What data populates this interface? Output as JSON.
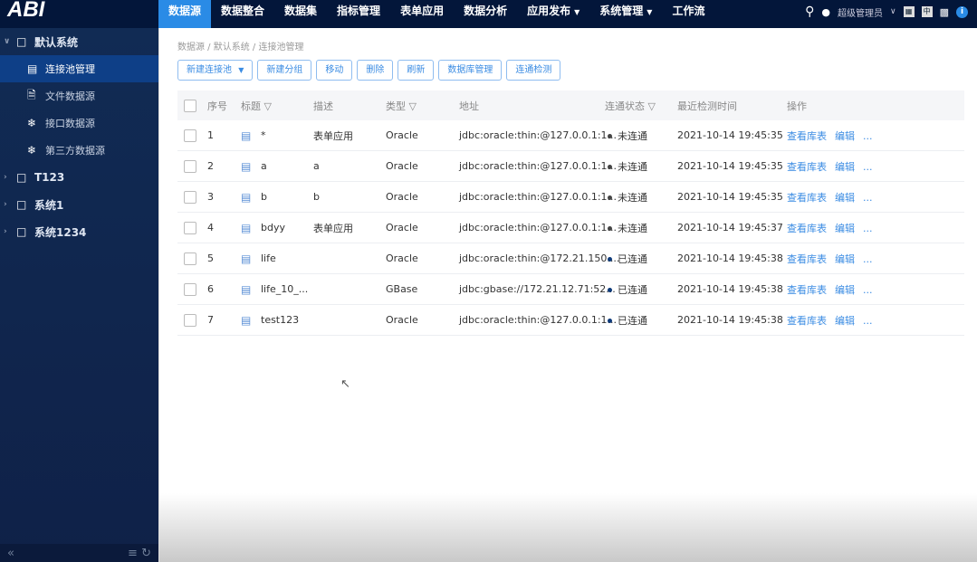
{
  "app": {
    "logo": "ABI"
  },
  "nav": [
    {
      "label": "数据源",
      "active": true
    },
    {
      "label": "数据整合"
    },
    {
      "label": "数据集"
    },
    {
      "label": "指标管理"
    },
    {
      "label": "表单应用"
    },
    {
      "label": "数据分析"
    },
    {
      "label": "应用发布",
      "dropdown": true
    },
    {
      "label": "系统管理",
      "dropdown": true
    },
    {
      "label": "工作流"
    }
  ],
  "header": {
    "user": "超级管理员",
    "lang": "中"
  },
  "sidebar": {
    "groups": [
      {
        "label": "默认系统",
        "expanded": true,
        "items": [
          {
            "label": "连接池管理",
            "selected": true
          },
          {
            "label": "文件数据源"
          },
          {
            "label": "接口数据源"
          },
          {
            "label": "第三方数据源"
          }
        ]
      },
      {
        "label": "T123"
      },
      {
        "label": "系统1"
      },
      {
        "label": "系统1234"
      }
    ]
  },
  "breadcrumb": "数据源 / 默认系统 / 连接池管理",
  "toolbar": {
    "new_pool": "新建连接池",
    "new_group": "新建分组",
    "move": "移动",
    "delete": "删除",
    "refresh": "刷新",
    "db_manage": "数据库管理",
    "check": "连通检测"
  },
  "table": {
    "headers": {
      "index": "序号",
      "title": "标题",
      "desc": "描述",
      "type": "类型",
      "address": "地址",
      "status": "连通状态",
      "time": "最近检测时间",
      "ops": "操作"
    },
    "ops": {
      "view": "查看库表",
      "edit": "编辑",
      "more": "..."
    },
    "status_colors": {
      "未连通": "#444444",
      "已连通": "#0d3a7a"
    },
    "rows": [
      {
        "index": "1",
        "title": "*",
        "desc": "表单应用",
        "type": "Oracle",
        "address": "jdbc:oracle:thin:@127.0.0.1:1...",
        "status": "未连通",
        "time": "2021-10-14 19:45:35"
      },
      {
        "index": "2",
        "title": "a",
        "desc": "a",
        "type": "Oracle",
        "address": "jdbc:oracle:thin:@127.0.0.1:1...",
        "status": "未连通",
        "time": "2021-10-14 19:45:35"
      },
      {
        "index": "3",
        "title": "b",
        "desc": "b",
        "type": "Oracle",
        "address": "jdbc:oracle:thin:@127.0.0.1:1...",
        "status": "未连通",
        "time": "2021-10-14 19:45:35"
      },
      {
        "index": "4",
        "title": "bdyy",
        "desc": "表单应用",
        "type": "Oracle",
        "address": "jdbc:oracle:thin:@127.0.0.1:1...",
        "status": "未连通",
        "time": "2021-10-14 19:45:37"
      },
      {
        "index": "5",
        "title": "life",
        "desc": "",
        "type": "Oracle",
        "address": "jdbc:oracle:thin:@172.21.150....",
        "status": "已连通",
        "time": "2021-10-14 19:45:38"
      },
      {
        "index": "6",
        "title": "life_10_...",
        "desc": "",
        "type": "GBase",
        "address": "jdbc:gbase://172.21.12.71:52...",
        "status": "已连通",
        "time": "2021-10-14 19:45:38"
      },
      {
        "index": "7",
        "title": "test123",
        "desc": "",
        "type": "Oracle",
        "address": "jdbc:oracle:thin:@127.0.0.1:1...",
        "status": "已连通",
        "time": "2021-10-14 19:45:38"
      }
    ]
  }
}
